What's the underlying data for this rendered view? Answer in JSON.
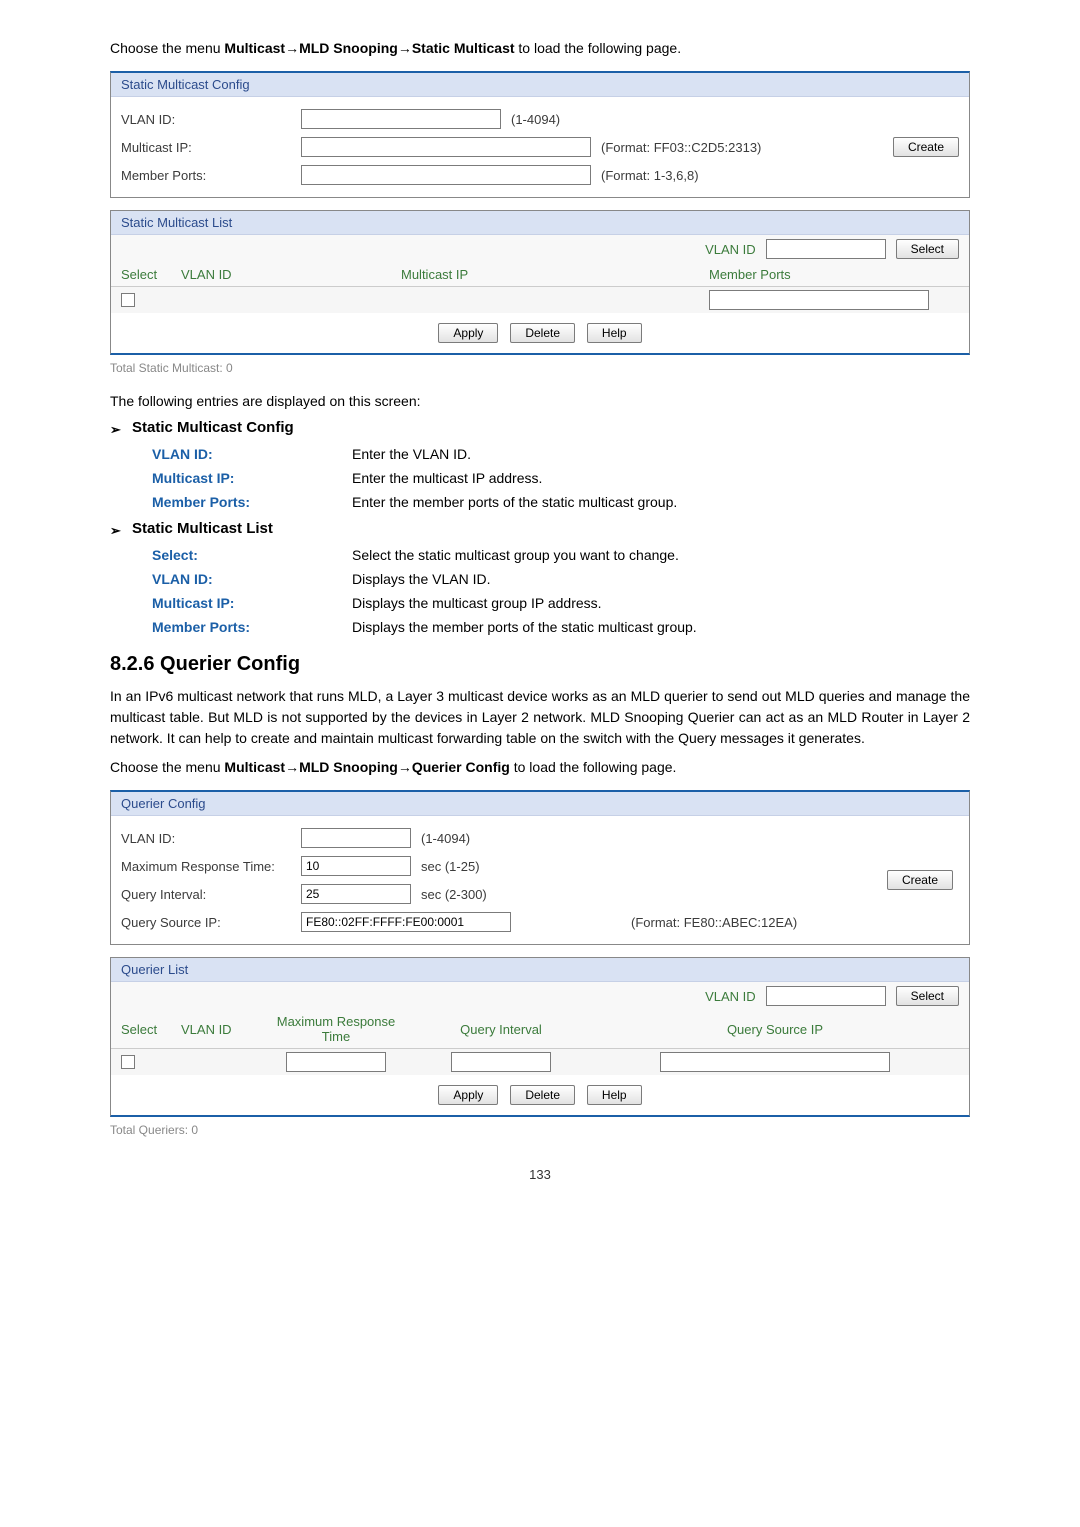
{
  "intro1_prefix": "Choose the menu ",
  "intro1_bold": "Multicast→MLD Snooping→Static Multicast",
  "intro1_suffix": " to load the following page.",
  "smc": {
    "panel_title": "Static Multicast Config",
    "vlan_label": "VLAN ID:",
    "vlan_range": "(1-4094)",
    "mip_label": "Multicast IP:",
    "mip_format": "(Format: FF03::C2D5:2313)",
    "ports_label": "Member Ports:",
    "ports_format": "(Format: 1-3,6,8)",
    "create_btn": "Create"
  },
  "sml": {
    "panel_title": "Static Multicast List",
    "filter_label": "VLAN ID",
    "select_btn": "Select",
    "col_select": "Select",
    "col_vlan": "VLAN ID",
    "col_mip": "Multicast IP",
    "col_ports": "Member Ports",
    "apply_btn": "Apply",
    "delete_btn": "Delete",
    "help_btn": "Help"
  },
  "footer1": "Total Static Multicast: 0",
  "entries_intro": "The following entries are displayed on this screen:",
  "sec1_title": "Static Multicast Config",
  "sec1_rows": {
    "r0_term": "VLAN ID:",
    "r0_desc": "Enter the VLAN ID.",
    "r1_term": "Multicast IP:",
    "r1_desc": "Enter the multicast IP address.",
    "r2_term": "Member Ports:",
    "r2_desc": "Enter the member ports of the static multicast group."
  },
  "sec2_title": "Static Multicast List",
  "sec2_rows": {
    "r0_term": "Select:",
    "r0_desc": "Select the static multicast group you want to change.",
    "r1_term": "VLAN ID:",
    "r1_desc": "Displays the VLAN ID.",
    "r2_term": "Multicast IP:",
    "r2_desc": "Displays the multicast group IP address.",
    "r3_term": "Member Ports:",
    "r3_desc": "Displays the member ports of the static multicast group."
  },
  "heading2": "8.2.6 Querier Config",
  "querier_para": "In an IPv6 multicast network that runs MLD, a Layer 3 multicast device works as an MLD querier to send out MLD queries and manage the multicast table. But MLD is not supported by the devices in Layer 2 network. MLD Snooping Querier can act as an MLD Router in Layer 2 network. It can help to create and maintain multicast forwarding table on the switch with the Query messages it generates.",
  "intro2_prefix": "Choose the menu ",
  "intro2_bold": "Multicast→MLD Snooping→Querier Config",
  "intro2_suffix": " to load the following page.",
  "qc": {
    "panel_title": "Querier Config",
    "vlan_label": "VLAN ID:",
    "vlan_range": "(1-4094)",
    "mrt_label": "Maximum Response Time:",
    "mrt_value": "10",
    "mrt_range": "sec (1-25)",
    "qi_label": "Query Interval:",
    "qi_value": "25",
    "qi_range": "sec (2-300)",
    "qsip_label": "Query Source IP:",
    "qsip_value": "FE80::02FF:FFFF:FE00:0001",
    "qsip_format": "(Format: FE80::ABEC:12EA)",
    "create_btn": "Create"
  },
  "ql": {
    "panel_title": "Querier List",
    "filter_label": "VLAN ID",
    "select_btn": "Select",
    "col_select": "Select",
    "col_vlan": "VLAN ID",
    "col_mrt": "Maximum Response Time",
    "col_qi": "Query Interval",
    "col_qsip": "Query Source IP",
    "apply_btn": "Apply",
    "delete_btn": "Delete",
    "help_btn": "Help"
  },
  "footer2": "Total Queriers: 0",
  "page_number": "133",
  "arrow_glyph": "➢"
}
